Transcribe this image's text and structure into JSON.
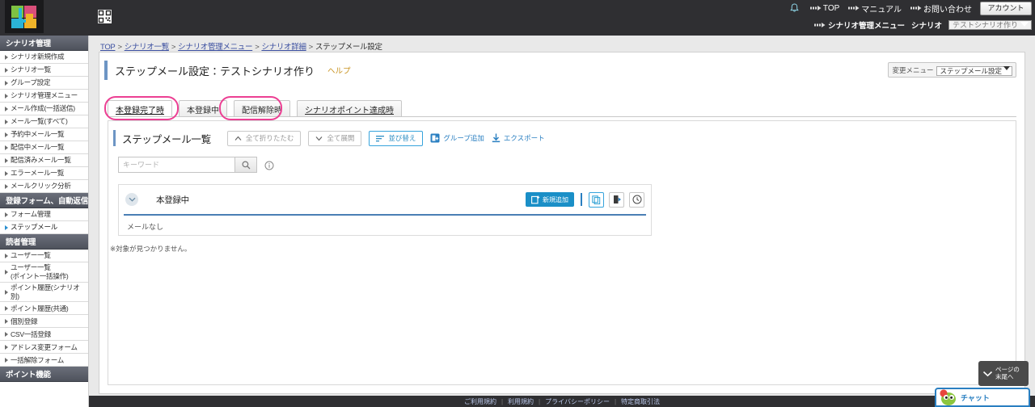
{
  "header": {
    "logo_alt": "lr-logo",
    "qr_icon": "qr-code-icon",
    "bell_icon": "bell-icon",
    "links": [
      {
        "label": "TOP"
      },
      {
        "label": "マニュアル"
      },
      {
        "label": "お問い合わせ"
      }
    ],
    "account_button": "アカウント",
    "scenario_menu_link": "シナリオ管理メニュー",
    "scenario_label": "シナリオ",
    "scenario_selected": "テストシナリオ作り"
  },
  "sidebar": {
    "sections": [
      {
        "title": "シナリオ管理",
        "items": [
          {
            "label": "シナリオ新規作成",
            "active": false
          },
          {
            "label": "シナリオ一覧",
            "active": false
          },
          {
            "label": "グループ設定",
            "active": false
          },
          {
            "label": "シナリオ管理メニュー",
            "active": false
          },
          {
            "label": "メール作成(一括送信)",
            "active": false
          },
          {
            "label": "メール一覧(すべて)",
            "active": false
          },
          {
            "label": "予約中メール一覧",
            "active": false
          },
          {
            "label": "配信中メール一覧",
            "active": false
          },
          {
            "label": "配信済みメール一覧",
            "active": false
          },
          {
            "label": "エラーメール一覧",
            "active": false
          },
          {
            "label": "メールクリック分析",
            "active": false
          }
        ]
      },
      {
        "title": "登録フォーム、自動返信",
        "items": [
          {
            "label": "フォーム管理",
            "active": false
          },
          {
            "label": "ステップメール",
            "active": true
          }
        ]
      },
      {
        "title": "読者管理",
        "items": [
          {
            "label": "ユーザー一覧",
            "active": false
          },
          {
            "label": "ユーザー一覧\n(ポイント一括操作)",
            "active": false,
            "two_line": true
          },
          {
            "label": "ポイント履歴(シナリオ別)",
            "active": false
          },
          {
            "label": "ポイント履歴(共通)",
            "active": false
          },
          {
            "label": "個別登録",
            "active": false
          },
          {
            "label": "CSV一括登録",
            "active": false
          },
          {
            "label": "アドレス変更フォーム",
            "active": false
          },
          {
            "label": "一括解除フォーム",
            "active": false
          }
        ]
      },
      {
        "title": "ポイント機能",
        "items": []
      }
    ]
  },
  "main": {
    "breadcrumb": [
      {
        "label": "TOP",
        "link": true
      },
      {
        "label": "シナリオ一覧",
        "link": true
      },
      {
        "label": "シナリオ管理メニュー",
        "link": true
      },
      {
        "label": "シナリオ詳細",
        "link": true
      },
      {
        "label": "ステップメール設定",
        "link": false
      }
    ],
    "page_title": "ステップメール設定：テストシナリオ作り",
    "help_label": "ヘルプ",
    "change_menu_label": "変更メニュー",
    "change_menu_value": "ステップメール設定",
    "tabs": [
      {
        "label": "本登録完了時",
        "selected": true,
        "annotated": true
      },
      {
        "label": "本登録中",
        "selected": false,
        "annotated": false
      },
      {
        "label": "配信解除時",
        "selected": false,
        "annotated": true
      },
      {
        "label": "シナリオポイント達成時",
        "selected": false,
        "annotated": false
      }
    ],
    "panel": {
      "title": "ステップメール一覧",
      "toolbar": [
        {
          "label": "全て折りたたむ",
          "icon": "chevron-up-icon",
          "style": "gray"
        },
        {
          "label": "全て展開",
          "icon": "chevron-down-icon",
          "style": "gray"
        },
        {
          "label": "並び替え",
          "icon": "sort-icon",
          "style": "blue-outline"
        },
        {
          "label": "グループ追加",
          "icon": "add-group-icon",
          "style": "plain"
        },
        {
          "label": "エクスポート",
          "icon": "download-icon",
          "style": "plain"
        }
      ],
      "search_placeholder": "キーワード",
      "search_value": "",
      "search_button_icon": "search-icon",
      "info_icon": "info-icon",
      "group": {
        "collapse_icon": "chevron-down-icon",
        "name": "本登録中",
        "add_button": "新規追加",
        "add_button_icon": "new-mail-icon",
        "action_icons": [
          {
            "name": "copy-icon"
          },
          {
            "name": "import-icon"
          },
          {
            "name": "clock-icon"
          }
        ],
        "body_text": "メールなし"
      },
      "no_result_text": "※対象が見つかりません。"
    }
  },
  "footer": {
    "links": [
      "ご利用規約",
      "利用規約",
      "プライバシーポリシー",
      "特定商取引法"
    ]
  },
  "widgets": {
    "page_bottom_line1": "ページの",
    "page_bottom_line2": "末尾へ",
    "page_bottom_icon": "chevron-down-icon",
    "chat_label": "チャット",
    "chat_icon": "mascot-icon"
  },
  "colors": {
    "accent_blue": "#1a8fc7",
    "annotation_pink": "#ec3f93",
    "topbar": "#2f2f32",
    "sidebar_section": "#5a5e68"
  }
}
